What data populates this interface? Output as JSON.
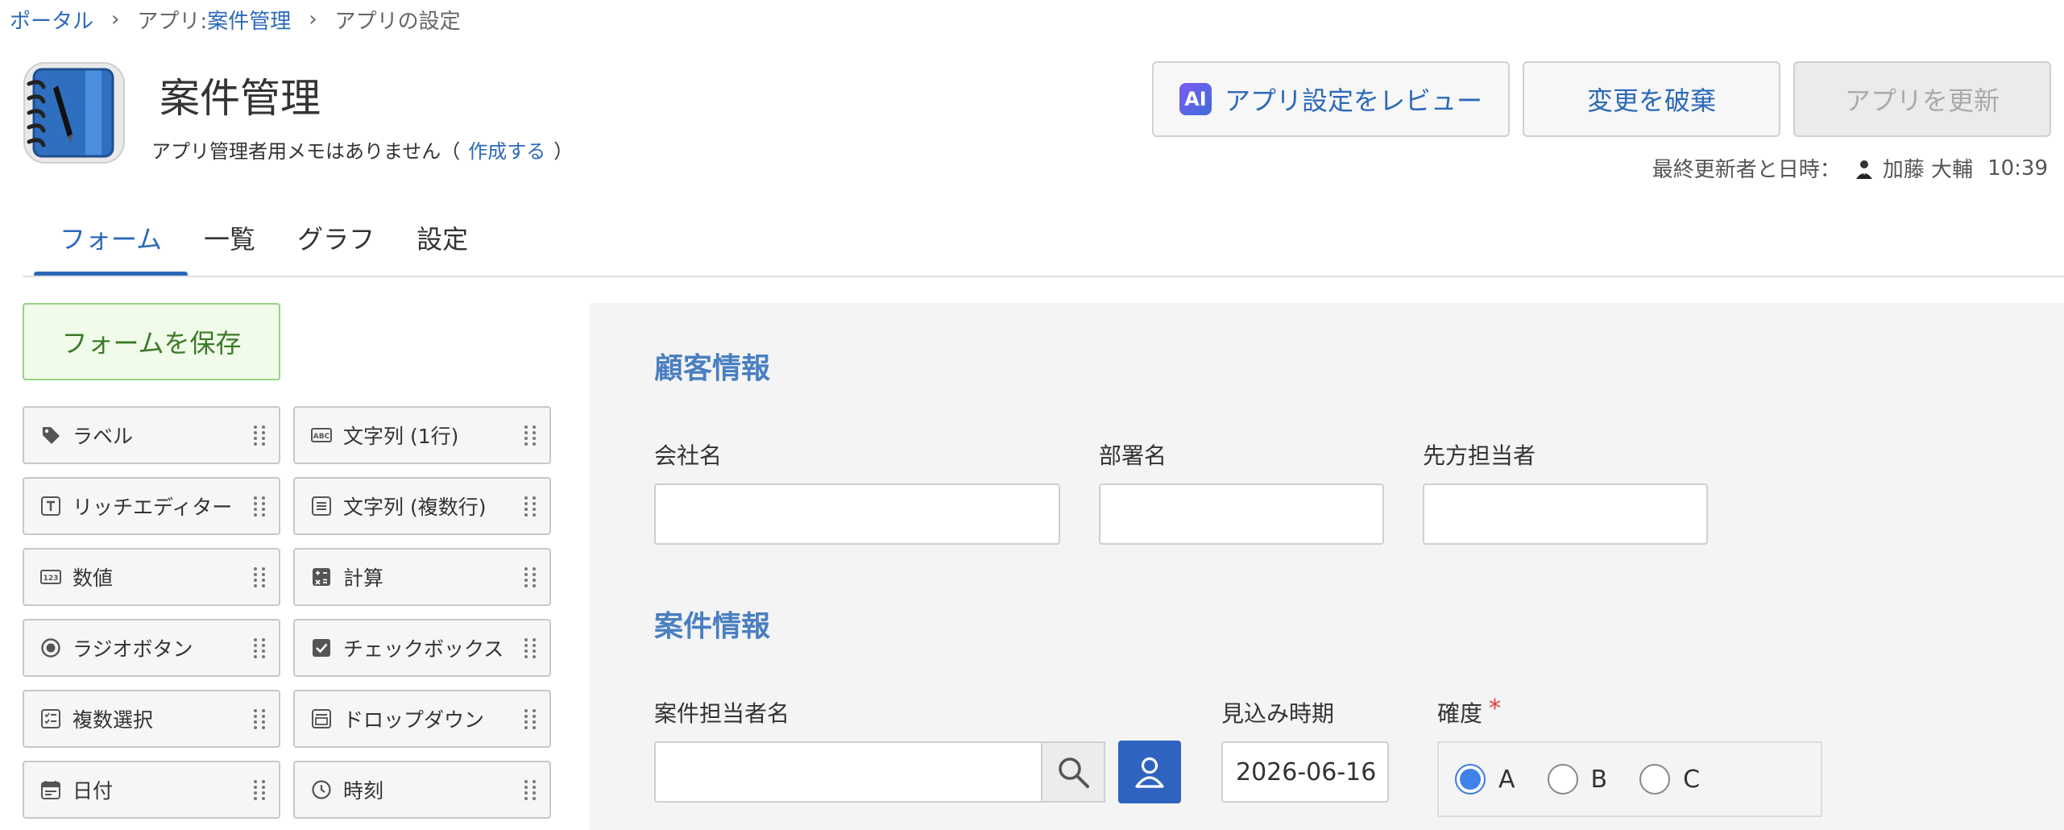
{
  "breadcrumb": {
    "portal": "ポータル",
    "app_prefix": "アプリ: ",
    "app_name": "案件管理",
    "current": "アプリの設定"
  },
  "app": {
    "title": "案件管理",
    "memo_text": "アプリ管理者用メモはありません（",
    "memo_link": "作成する",
    "memo_close": "）"
  },
  "header_buttons": {
    "ai_badge": "AI",
    "review": "アプリ設定をレビュー",
    "discard": "変更を破棄",
    "update": "アプリを更新"
  },
  "last_updated": {
    "label": "最終更新者と日時：",
    "user": "加藤 大輔",
    "time": "10:39"
  },
  "tabs": [
    {
      "label": "フォーム",
      "active": true
    },
    {
      "label": "一覧",
      "active": false
    },
    {
      "label": "グラフ",
      "active": false
    },
    {
      "label": "設定",
      "active": false
    }
  ],
  "palette": {
    "save_label": "フォームを保存",
    "items": [
      {
        "label": "ラベル",
        "icon": "tag-icon"
      },
      {
        "label": "文字列 (1行)",
        "icon": "abc-icon"
      },
      {
        "label": "リッチエディター",
        "icon": "text-format-icon"
      },
      {
        "label": "文字列 (複数行)",
        "icon": "lines-icon"
      },
      {
        "label": "数値",
        "icon": "number-icon"
      },
      {
        "label": "計算",
        "icon": "calculator-icon"
      },
      {
        "label": "ラジオボタン",
        "icon": "radio-icon"
      },
      {
        "label": "チェックボックス",
        "icon": "checkbox-icon"
      },
      {
        "label": "複数選択",
        "icon": "multi-select-icon"
      },
      {
        "label": "ドロップダウン",
        "icon": "dropdown-icon"
      },
      {
        "label": "日付",
        "icon": "calendar-icon"
      },
      {
        "label": "時刻",
        "icon": "clock-icon"
      }
    ]
  },
  "form": {
    "customer_section": "顧客情報",
    "company_label": "会社名",
    "department_label": "部署名",
    "contact_label": "先方担当者",
    "deal_section": "案件情報",
    "owner_label": "案件担当者名",
    "expected_label": "見込み時期",
    "expected_value": "2026-06-16",
    "certainty_label": "確度",
    "required_mark": "*",
    "certainty_options": [
      "A",
      "B",
      "C"
    ],
    "certainty_selected": "A"
  },
  "colors": {
    "link": "#2b69b8",
    "primary_button": "#2e64c0",
    "save_border": "#99d185",
    "section_title": "#4a7fc1"
  }
}
